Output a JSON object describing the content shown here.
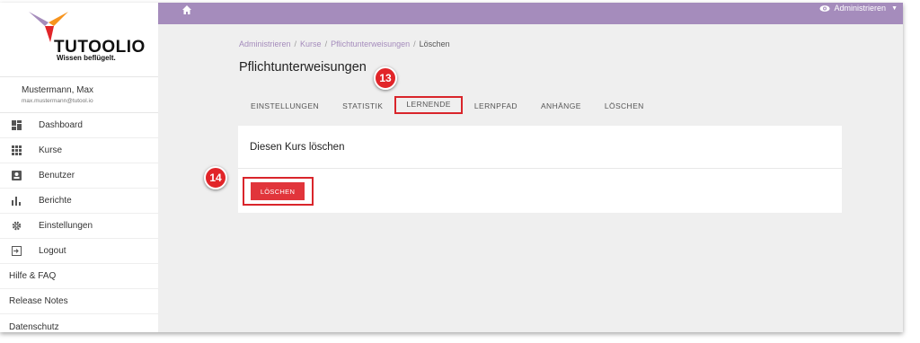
{
  "brand": {
    "name": "TUTOOLIO",
    "tagline": "Wissen beflügelt.",
    "colors": {
      "purple": "#a58cbc",
      "red": "#e12529",
      "orange": "#f7941d"
    }
  },
  "user": {
    "name": "Mustermann, Max",
    "email": "max.mustermann@tutool.io"
  },
  "sidebar": {
    "items": [
      {
        "label": "Dashboard",
        "icon": "dashboard-icon"
      },
      {
        "label": "Kurse",
        "icon": "grid-icon"
      },
      {
        "label": "Benutzer",
        "icon": "user-card-icon"
      },
      {
        "label": "Berichte",
        "icon": "bar-chart-icon"
      },
      {
        "label": "Einstellungen",
        "icon": "gear-icon"
      },
      {
        "label": "Logout",
        "icon": "logout-icon"
      }
    ],
    "links": [
      "Hilfe & FAQ",
      "Release Notes",
      "Datenschutz"
    ]
  },
  "topbar": {
    "admin_label": "Administrieren",
    "home_icon": "home-icon",
    "view_icon": "eye-icon"
  },
  "breadcrumb": [
    "Administrieren",
    "Kurse",
    "Pflichtunterweisungen",
    "Löschen"
  ],
  "page_title": "Pflichtunterweisungen",
  "tabs": [
    "EINSTELLUNGEN",
    "STATISTIK",
    "LERNENDE",
    "LERNPFAD",
    "ANHÄNGE",
    "LÖSCHEN"
  ],
  "card": {
    "title": "Diesen Kurs löschen",
    "button_label": "LÖSCHEN"
  },
  "steps": {
    "tab_step": "13",
    "button_step": "14"
  }
}
